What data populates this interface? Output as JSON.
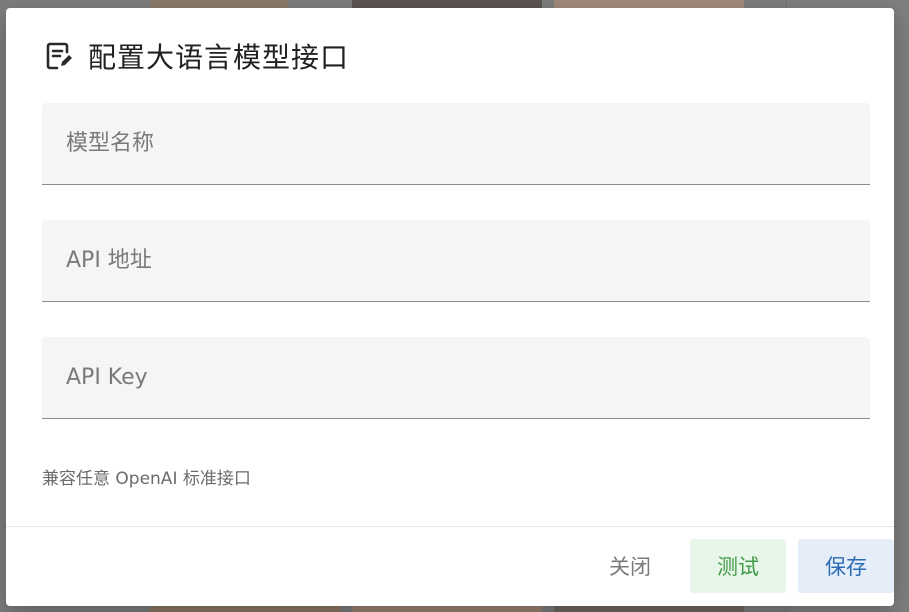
{
  "dialog": {
    "title": "配置大语言模型接口",
    "icon": "edit-note-icon",
    "fields": {
      "model_name": {
        "placeholder": "模型名称",
        "value": ""
      },
      "api_url": {
        "placeholder": "API 地址",
        "value": ""
      },
      "api_key": {
        "placeholder": "API Key",
        "value": ""
      }
    },
    "hint": "兼容任意 OpenAI 标准接口",
    "buttons": {
      "close": "关闭",
      "test": "测试",
      "save": "保存"
    }
  },
  "colors": {
    "test_text": "#3f9b47",
    "test_bg": "#e8f5e9",
    "save_text": "#2c6cb5",
    "save_bg": "#e5edf8",
    "scrim": "#7d7d7d"
  }
}
